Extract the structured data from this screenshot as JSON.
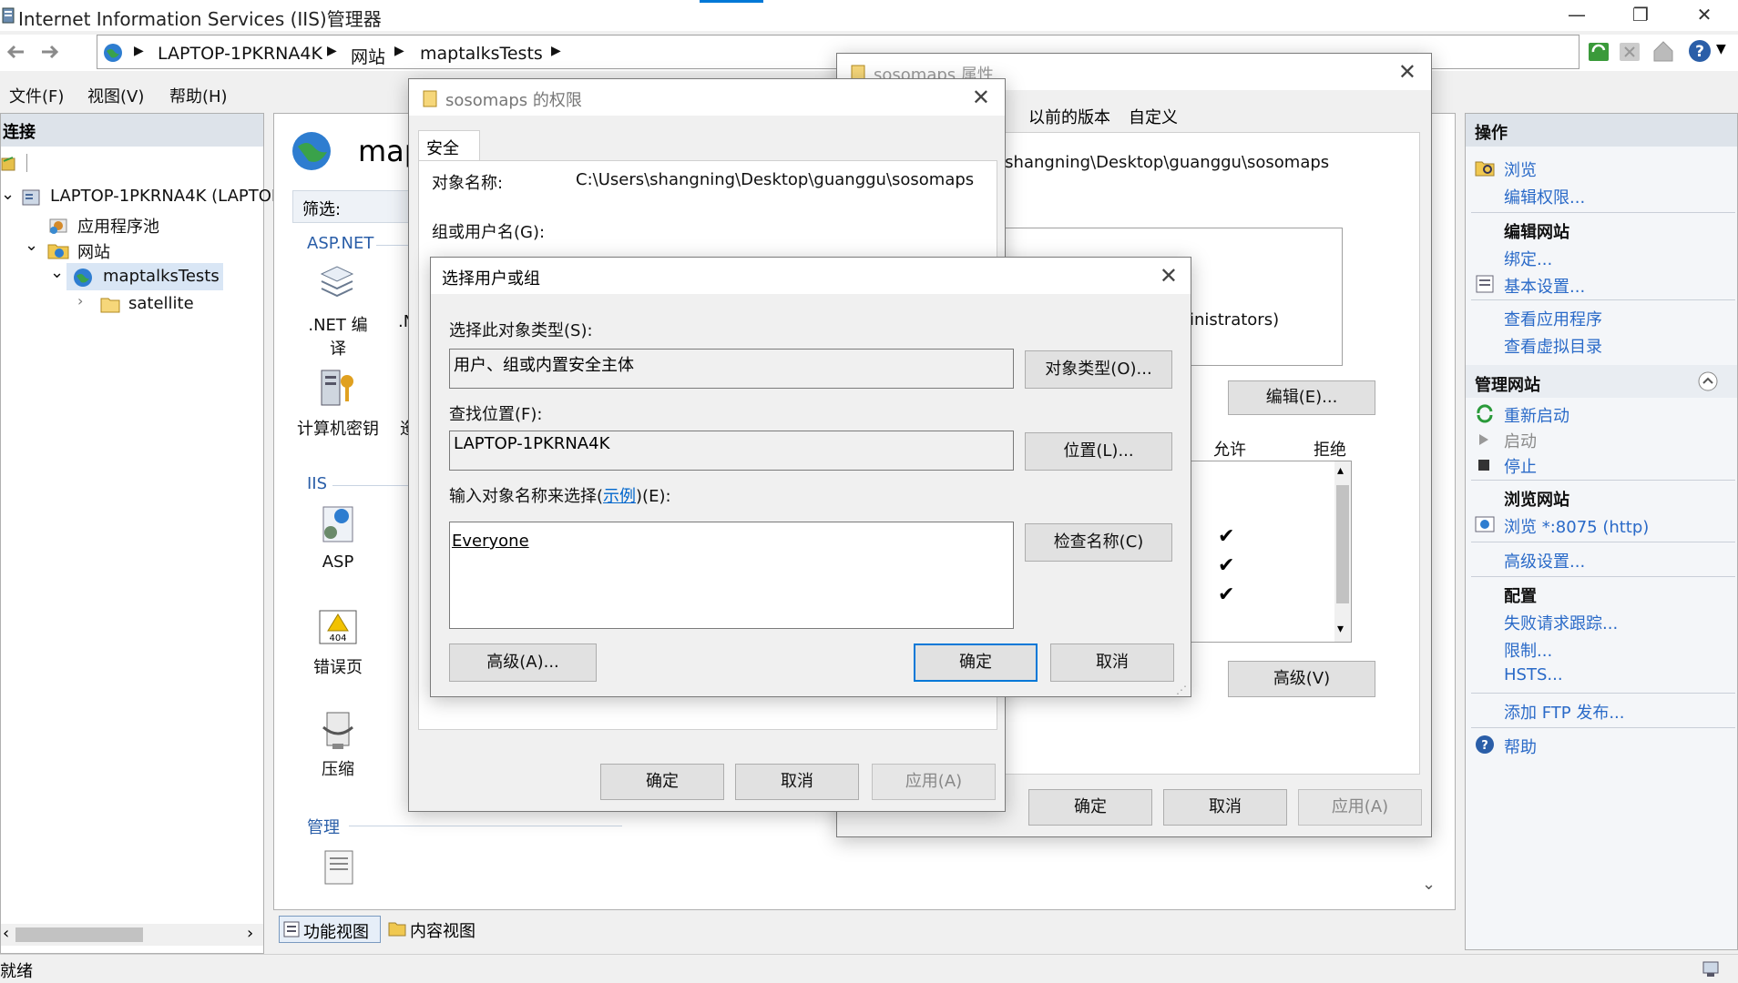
{
  "window": {
    "title": "Internet Information Services (IIS)管理器",
    "minimize": "—",
    "restore": "❐",
    "close": "✕"
  },
  "address": {
    "crumbs": [
      "LAPTOP-1PKRNA4K",
      "网站",
      "maptalksTests"
    ]
  },
  "menu": [
    "文件(F)",
    "视图(V)",
    "帮助(H)"
  ],
  "left": {
    "header": "连接",
    "tree": {
      "server": "LAPTOP-1PKRNA4K (LAPTOP",
      "app_pools": "应用程序池",
      "sites": "网站",
      "site": "maptalksTests",
      "child": "satellite"
    }
  },
  "center": {
    "title": "map",
    "filter_label": "筛选:",
    "sections": {
      "aspnet": "ASP.NET",
      "iis": "IIS",
      "manage": "管理"
    },
    "features": {
      "net_compile": ".NET 编译",
      "net_partial": ".N",
      "machine_key": "计算机密钥",
      "machine_key_next": "迤",
      "asp": "ASP",
      "error_pages": "错误页",
      "compression": "压缩"
    },
    "view_tabs": [
      "功能视图",
      "内容视图"
    ]
  },
  "status": {
    "text": "就绪"
  },
  "right": {
    "header": "操作",
    "browse": "浏览",
    "edit_perms": "编辑权限...",
    "edit_site_head": "编辑网站",
    "bindings": "绑定...",
    "basic_settings": "基本设置...",
    "view_apps": "查看应用程序",
    "view_vdirs": "查看虚拟目录",
    "manage_site_head": "管理网站",
    "restart": "重新启动",
    "start": "启动",
    "stop": "停止",
    "browse_site_head": "浏览网站",
    "browse_port": "浏览 *:8075 (http)",
    "advanced": "高级设置...",
    "config_head": "配置",
    "failed_trace": "失败请求跟踪...",
    "limits": "限制...",
    "hsts": "HSTS...",
    "add_ftp": "添加 FTP 发布...",
    "help": "帮助"
  },
  "props_dialog": {
    "title": "sosomaps 属性",
    "tab_prev": "以前的版本",
    "tab_custom": "自定义",
    "object_path": "C:\\Users\\shangning\\Desktop\\guanggu\\sosomaps",
    "admin_entry": "Administrators)",
    "edit_btn": "编辑(E)...",
    "allow": "允许",
    "deny": "拒绝",
    "checks": [
      "✔",
      "✔",
      "✔"
    ],
    "advanced_btn": "高级(V)",
    "ok": "确定",
    "cancel": "取消",
    "apply": "应用(A)"
  },
  "perm_dialog": {
    "title": "sosomaps 的权限",
    "tab": "安全",
    "object_label": "对象名称:",
    "object_value": "C:\\Users\\shangning\\Desktop\\guanggu\\sosomaps",
    "group_label": "组或用户名(G):",
    "ok": "确定",
    "cancel": "取消",
    "apply": "应用(A)"
  },
  "select_dialog": {
    "title": "选择用户或组",
    "obj_type_label": "选择此对象类型(S):",
    "obj_type_value": "用户、组或内置安全主体",
    "obj_type_btn": "对象类型(O)...",
    "location_label": "查找位置(F):",
    "location_value": "LAPTOP-1PKRNA4K",
    "location_btn": "位置(L)...",
    "names_label_pre": "输入对象名称来选择(",
    "names_label_link": "示例",
    "names_label_post": ")(E):",
    "names_value": "Everyone",
    "check_btn": "检查名称(C)",
    "advanced_btn": "高级(A)...",
    "ok": "确定",
    "cancel": "取消"
  }
}
